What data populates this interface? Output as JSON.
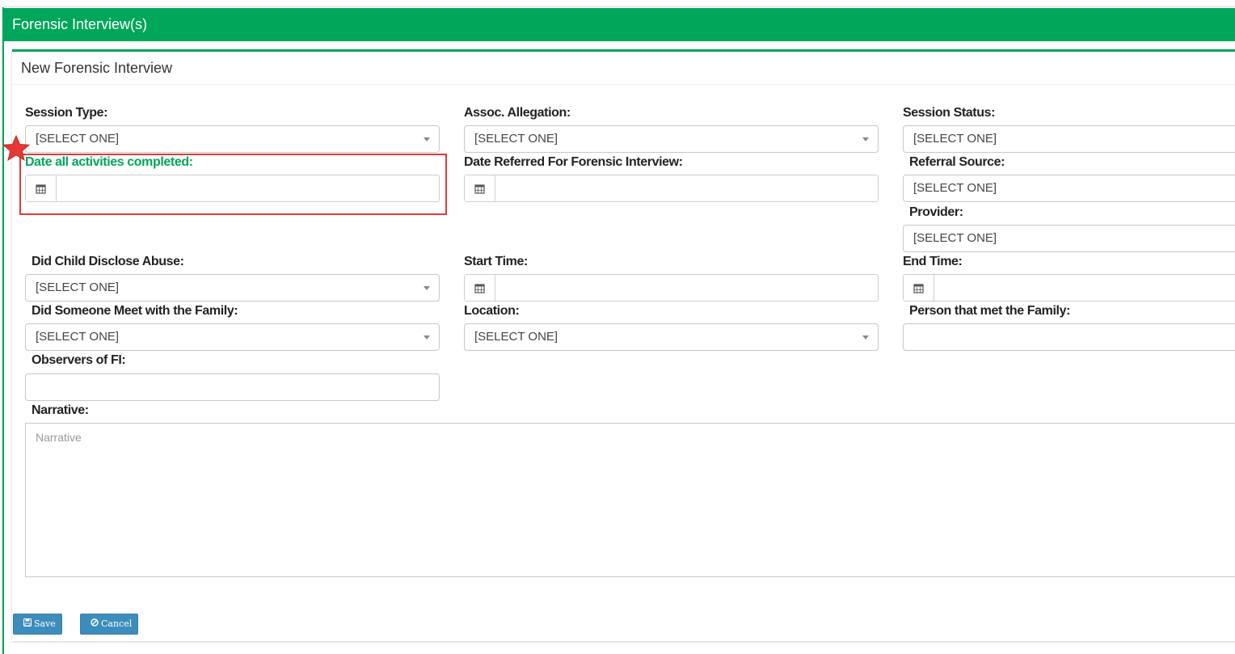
{
  "window": {
    "title": "Forensic Interview(s)"
  },
  "panel": {
    "title": "New Forensic Interview"
  },
  "fields": {
    "session_type": {
      "label": "Session Type:",
      "value": "[SELECT ONE]"
    },
    "assoc_allegation": {
      "label": "Assoc. Allegation:",
      "value": "[SELECT ONE]"
    },
    "session_status": {
      "label": "Session Status:",
      "value": "[SELECT ONE]"
    },
    "date_completed": {
      "label": "Date all activities completed:",
      "value": ""
    },
    "date_referred": {
      "label": "Date Referred For Forensic Interview:",
      "value": ""
    },
    "referral_source": {
      "label": "Referral Source:",
      "value": "[SELECT ONE]"
    },
    "provider": {
      "label": "Provider:",
      "value": "[SELECT ONE]"
    },
    "child_disclose": {
      "label": "Did Child Disclose Abuse:",
      "value": "[SELECT ONE]"
    },
    "start_time": {
      "label": "Start Time:",
      "value": ""
    },
    "end_time": {
      "label": "End Time:",
      "value": ""
    },
    "met_family": {
      "label": "Did Someone Meet with the Family:",
      "value": "[SELECT ONE]"
    },
    "location": {
      "label": "Location:",
      "value": "[SELECT ONE]"
    },
    "person_met_family": {
      "label": "Person that met the Family:",
      "value": ""
    },
    "observers": {
      "label": "Observers of FI:",
      "value": ""
    },
    "narrative": {
      "label": "Narrative:",
      "placeholder": "Narrative"
    }
  },
  "buttons": {
    "save": "Save",
    "cancel": "Cancel"
  },
  "colors": {
    "header": "#00a65a",
    "button": "#3c8dbc",
    "highlight": "#e53935",
    "required_star": "#e53935"
  },
  "icons": {
    "date_addon": "calendar-icon",
    "required": "star-icon",
    "save": "floppy-disk-icon",
    "cancel": "ban-icon"
  }
}
